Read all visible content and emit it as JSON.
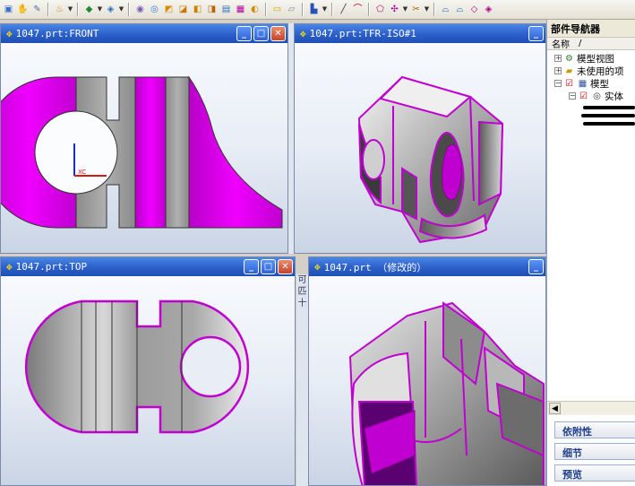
{
  "toolbar": {
    "icons": [
      "view-icon",
      "rotate-icon",
      "zoom-icon",
      "display-icon",
      "shade-icon",
      "color-icon",
      "sphere-icon",
      "render-icon",
      "layer-icon",
      "cube-icon",
      "sheet-icon",
      "measure-icon",
      "line-icon",
      "curve-icon",
      "pen-icon",
      "brush-icon",
      "surface-icon",
      "tool-icon"
    ]
  },
  "views": {
    "front": {
      "title": "1047.prt:FRONT",
      "axis_label": "XC"
    },
    "iso": {
      "title": "1047.prt:TFR-ISO#1"
    },
    "top": {
      "title": "1047.prt:TOP",
      "axis_label": "XC"
    },
    "modified": {
      "title": "1047.prt （修改的）"
    }
  },
  "window_buttons": {
    "minimize": "_",
    "maximize": "□",
    "close": "✕"
  },
  "navigator": {
    "title": "部件导航器",
    "column": "名称",
    "sort_mark": "/",
    "items": [
      {
        "label": "模型视图",
        "expander": "+"
      },
      {
        "label": "未使用的项",
        "expander": "+"
      },
      {
        "label": "模型",
        "expander": "−"
      },
      {
        "label": "实体",
        "expander": "−"
      }
    ],
    "panels": [
      "依附性",
      "细节",
      "预览"
    ]
  },
  "strip_text": "可 匹 十",
  "colors": {
    "magenta": "#e000e8",
    "accent": "#2b5fc9"
  }
}
